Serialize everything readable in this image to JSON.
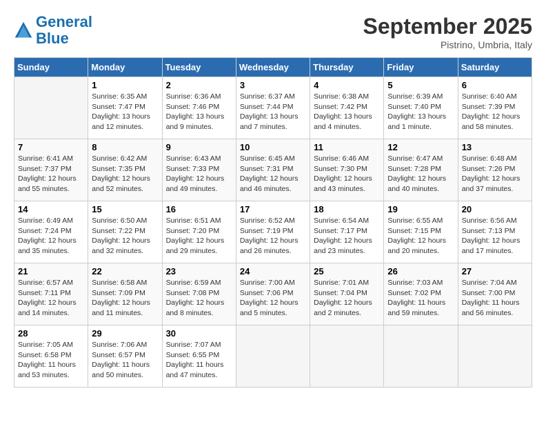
{
  "header": {
    "logo_line1": "General",
    "logo_line2": "Blue",
    "month": "September 2025",
    "location": "Pistrino, Umbria, Italy"
  },
  "columns": [
    "Sunday",
    "Monday",
    "Tuesday",
    "Wednesday",
    "Thursday",
    "Friday",
    "Saturday"
  ],
  "weeks": [
    [
      {
        "day": "",
        "empty": true
      },
      {
        "day": "1",
        "sunrise": "Sunrise: 6:35 AM",
        "sunset": "Sunset: 7:47 PM",
        "daylight": "Daylight: 13 hours and 12 minutes."
      },
      {
        "day": "2",
        "sunrise": "Sunrise: 6:36 AM",
        "sunset": "Sunset: 7:46 PM",
        "daylight": "Daylight: 13 hours and 9 minutes."
      },
      {
        "day": "3",
        "sunrise": "Sunrise: 6:37 AM",
        "sunset": "Sunset: 7:44 PM",
        "daylight": "Daylight: 13 hours and 7 minutes."
      },
      {
        "day": "4",
        "sunrise": "Sunrise: 6:38 AM",
        "sunset": "Sunset: 7:42 PM",
        "daylight": "Daylight: 13 hours and 4 minutes."
      },
      {
        "day": "5",
        "sunrise": "Sunrise: 6:39 AM",
        "sunset": "Sunset: 7:40 PM",
        "daylight": "Daylight: 13 hours and 1 minute."
      },
      {
        "day": "6",
        "sunrise": "Sunrise: 6:40 AM",
        "sunset": "Sunset: 7:39 PM",
        "daylight": "Daylight: 12 hours and 58 minutes."
      }
    ],
    [
      {
        "day": "7",
        "sunrise": "Sunrise: 6:41 AM",
        "sunset": "Sunset: 7:37 PM",
        "daylight": "Daylight: 12 hours and 55 minutes."
      },
      {
        "day": "8",
        "sunrise": "Sunrise: 6:42 AM",
        "sunset": "Sunset: 7:35 PM",
        "daylight": "Daylight: 12 hours and 52 minutes."
      },
      {
        "day": "9",
        "sunrise": "Sunrise: 6:43 AM",
        "sunset": "Sunset: 7:33 PM",
        "daylight": "Daylight: 12 hours and 49 minutes."
      },
      {
        "day": "10",
        "sunrise": "Sunrise: 6:45 AM",
        "sunset": "Sunset: 7:31 PM",
        "daylight": "Daylight: 12 hours and 46 minutes."
      },
      {
        "day": "11",
        "sunrise": "Sunrise: 6:46 AM",
        "sunset": "Sunset: 7:30 PM",
        "daylight": "Daylight: 12 hours and 43 minutes."
      },
      {
        "day": "12",
        "sunrise": "Sunrise: 6:47 AM",
        "sunset": "Sunset: 7:28 PM",
        "daylight": "Daylight: 12 hours and 40 minutes."
      },
      {
        "day": "13",
        "sunrise": "Sunrise: 6:48 AM",
        "sunset": "Sunset: 7:26 PM",
        "daylight": "Daylight: 12 hours and 37 minutes."
      }
    ],
    [
      {
        "day": "14",
        "sunrise": "Sunrise: 6:49 AM",
        "sunset": "Sunset: 7:24 PM",
        "daylight": "Daylight: 12 hours and 35 minutes."
      },
      {
        "day": "15",
        "sunrise": "Sunrise: 6:50 AM",
        "sunset": "Sunset: 7:22 PM",
        "daylight": "Daylight: 12 hours and 32 minutes."
      },
      {
        "day": "16",
        "sunrise": "Sunrise: 6:51 AM",
        "sunset": "Sunset: 7:20 PM",
        "daylight": "Daylight: 12 hours and 29 minutes."
      },
      {
        "day": "17",
        "sunrise": "Sunrise: 6:52 AM",
        "sunset": "Sunset: 7:19 PM",
        "daylight": "Daylight: 12 hours and 26 minutes."
      },
      {
        "day": "18",
        "sunrise": "Sunrise: 6:54 AM",
        "sunset": "Sunset: 7:17 PM",
        "daylight": "Daylight: 12 hours and 23 minutes."
      },
      {
        "day": "19",
        "sunrise": "Sunrise: 6:55 AM",
        "sunset": "Sunset: 7:15 PM",
        "daylight": "Daylight: 12 hours and 20 minutes."
      },
      {
        "day": "20",
        "sunrise": "Sunrise: 6:56 AM",
        "sunset": "Sunset: 7:13 PM",
        "daylight": "Daylight: 12 hours and 17 minutes."
      }
    ],
    [
      {
        "day": "21",
        "sunrise": "Sunrise: 6:57 AM",
        "sunset": "Sunset: 7:11 PM",
        "daylight": "Daylight: 12 hours and 14 minutes."
      },
      {
        "day": "22",
        "sunrise": "Sunrise: 6:58 AM",
        "sunset": "Sunset: 7:09 PM",
        "daylight": "Daylight: 12 hours and 11 minutes."
      },
      {
        "day": "23",
        "sunrise": "Sunrise: 6:59 AM",
        "sunset": "Sunset: 7:08 PM",
        "daylight": "Daylight: 12 hours and 8 minutes."
      },
      {
        "day": "24",
        "sunrise": "Sunrise: 7:00 AM",
        "sunset": "Sunset: 7:06 PM",
        "daylight": "Daylight: 12 hours and 5 minutes."
      },
      {
        "day": "25",
        "sunrise": "Sunrise: 7:01 AM",
        "sunset": "Sunset: 7:04 PM",
        "daylight": "Daylight: 12 hours and 2 minutes."
      },
      {
        "day": "26",
        "sunrise": "Sunrise: 7:03 AM",
        "sunset": "Sunset: 7:02 PM",
        "daylight": "Daylight: 11 hours and 59 minutes."
      },
      {
        "day": "27",
        "sunrise": "Sunrise: 7:04 AM",
        "sunset": "Sunset: 7:00 PM",
        "daylight": "Daylight: 11 hours and 56 minutes."
      }
    ],
    [
      {
        "day": "28",
        "sunrise": "Sunrise: 7:05 AM",
        "sunset": "Sunset: 6:58 PM",
        "daylight": "Daylight: 11 hours and 53 minutes."
      },
      {
        "day": "29",
        "sunrise": "Sunrise: 7:06 AM",
        "sunset": "Sunset: 6:57 PM",
        "daylight": "Daylight: 11 hours and 50 minutes."
      },
      {
        "day": "30",
        "sunrise": "Sunrise: 7:07 AM",
        "sunset": "Sunset: 6:55 PM",
        "daylight": "Daylight: 11 hours and 47 minutes."
      },
      {
        "day": "",
        "empty": true
      },
      {
        "day": "",
        "empty": true
      },
      {
        "day": "",
        "empty": true
      },
      {
        "day": "",
        "empty": true
      }
    ]
  ]
}
